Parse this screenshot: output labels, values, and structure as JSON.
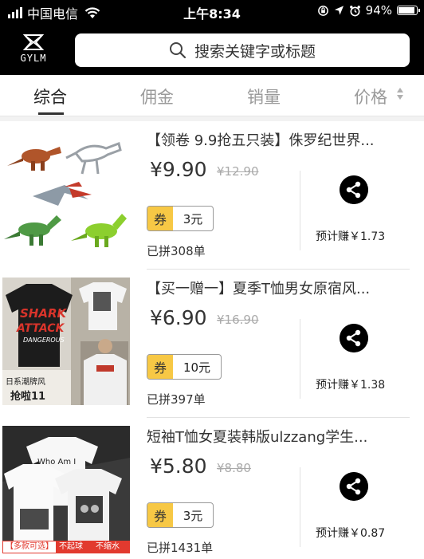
{
  "status_bar": {
    "carrier": "中国电信",
    "time": "上午8:34",
    "battery": "94%",
    "battery_level": 0.94
  },
  "header": {
    "logo_text": "GYLM",
    "search_placeholder": "搜索关键字或标题"
  },
  "tabs": [
    {
      "label": "综合"
    },
    {
      "label": "佣金"
    },
    {
      "label": "销量"
    },
    {
      "label": "价格"
    }
  ],
  "products": [
    {
      "title": "【领卷 9.9抢五只装】侏罗纪世界...",
      "price": "¥9.90",
      "old_price": "¥12.90",
      "coupon_label": "券",
      "coupon_value": "3元",
      "sold": "已拼308单",
      "earn": "预计赚￥1.73"
    },
    {
      "title": "【买一赠一】夏季T恤男女原宿风...",
      "price": "¥6.90",
      "old_price": "¥16.90",
      "coupon_label": "券",
      "coupon_value": "10元",
      "sold": "已拼397单",
      "earn": "预计赚￥1.38",
      "thumb_text": {
        "shirt_line1": "SHARK",
        "shirt_line2": "ATTACK",
        "shirt_line3": "DANGEROUS",
        "caption": "日系潮牌风",
        "caption2": "抢啦11"
      }
    },
    {
      "title": "短袖T恤女夏装韩版ulzzang学生...",
      "price": "¥5.80",
      "old_price": "¥8.80",
      "coupon_label": "券",
      "coupon_value": "3元",
      "sold": "已拼1431单",
      "earn": "预计赚￥0.87",
      "thumb_text": {
        "shirt_line1": "Who Am I",
        "tag_a": "【多款可选】",
        "tag_b1": "不起球",
        "tag_b2": "不缩水"
      }
    }
  ],
  "icons": {
    "search": "search-icon",
    "share": "share-icon",
    "logo": "logo-icon"
  },
  "colors": {
    "coupon_bg": "#f7c845",
    "header_bg": "#000000",
    "tag_red": "#e23a2f"
  }
}
